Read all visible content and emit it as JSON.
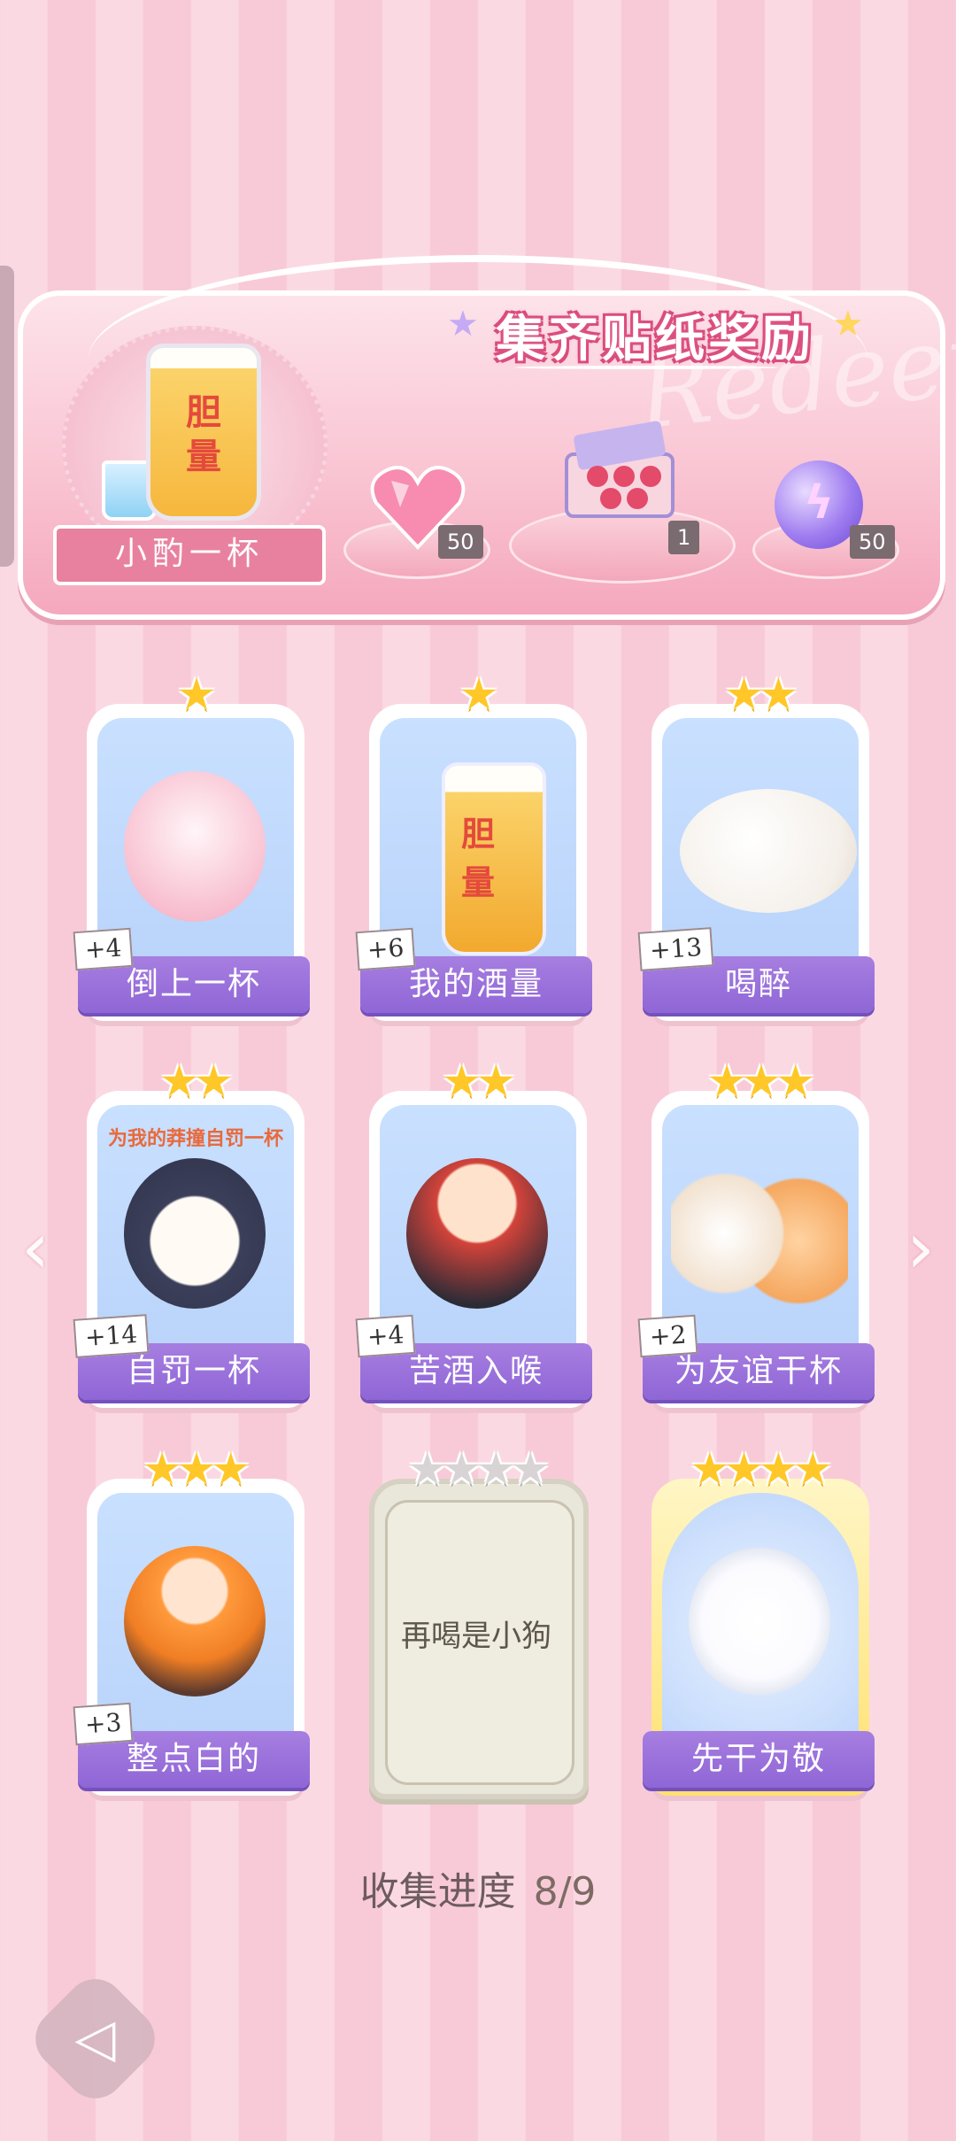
{
  "banner": {
    "title": "集齐贴纸奖励",
    "watermark": "Redeem",
    "main_reward_label": "小酌一杯",
    "main_reward_glass_text": [
      "胆",
      "量"
    ],
    "rewards": [
      {
        "icon": "pink-heart-gem-icon",
        "count": "50"
      },
      {
        "icon": "gift-box-icon",
        "count": "1"
      },
      {
        "icon": "purple-energy-orb-icon",
        "count": "50"
      }
    ]
  },
  "cards": [
    {
      "name": "倒上一杯",
      "stars": 1,
      "bonus": "+4",
      "art": "sheep-pouring-beer"
    },
    {
      "name": "我的酒量",
      "stars": 1,
      "bonus": "+6",
      "art": "beer-glass-courage",
      "art_text": [
        "胆",
        "量"
      ]
    },
    {
      "name": "喝醉",
      "stars": 2,
      "bonus": "+13",
      "art": "drunk-cat"
    },
    {
      "name": "自罚一杯",
      "stars": 2,
      "bonus": "+14",
      "art": "penguin-wine",
      "art_text": [
        "为我的莽撞自罚一杯"
      ]
    },
    {
      "name": "苦酒入喉",
      "stars": 2,
      "bonus": "+4",
      "art": "red-hair-boy-beer"
    },
    {
      "name": "为友谊干杯",
      "stars": 3,
      "bonus": "+2",
      "art": "dog-cat-cheers"
    },
    {
      "name": "整点白的",
      "stars": 3,
      "bonus": "+3",
      "art": "orange-hair-girl"
    },
    {
      "name": "再喝是小狗",
      "stars": 4,
      "bonus": "",
      "art": "locked",
      "locked": true
    },
    {
      "name": "先干为敬",
      "stars": 4,
      "bonus": "",
      "art": "duck-beer-mug",
      "gold": true
    }
  ],
  "progress": {
    "label": "收集进度",
    "value": "8/9"
  },
  "nav": {
    "left_arrow": "‹",
    "right_arrow": "›",
    "back_icon": "back-arrow-icon"
  },
  "colors": {
    "card_banner": "#9a70da",
    "star": "#ffc727",
    "background_pink": "#fbd9e3"
  }
}
